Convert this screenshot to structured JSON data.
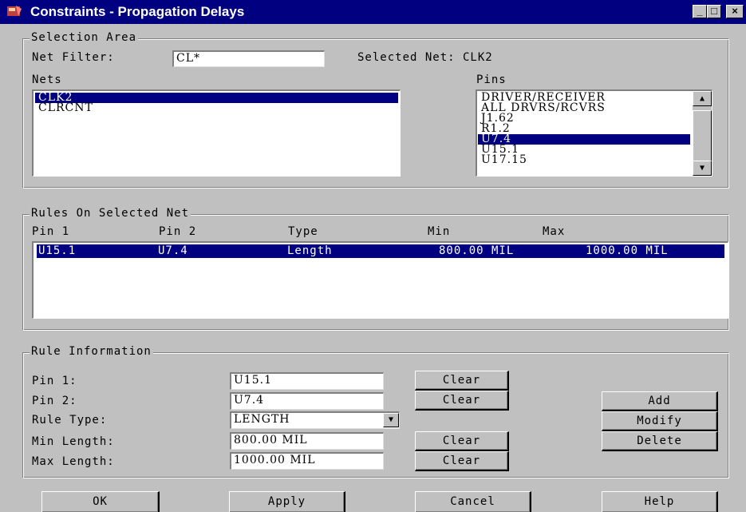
{
  "window": {
    "title": "Constraints - Propagation Delays",
    "controls": {
      "minimize": "_",
      "maximize": "□",
      "close": "×"
    }
  },
  "selection_area": {
    "legend": "Selection Area",
    "net_filter_label": "Net Filter:",
    "net_filter_value": "CL*",
    "selected_net_text": "Selected Net: CLK2",
    "nets_label": "Nets",
    "nets": [
      {
        "label": "CLK2",
        "selected": true
      },
      {
        "label": "CLRCNT",
        "selected": false
      }
    ],
    "pins_label": "Pins",
    "pins": [
      {
        "label": "DRIVER/RECEIVER",
        "selected": false
      },
      {
        "label": "ALL DRVRS/RCVRS",
        "selected": false
      },
      {
        "label": "J1.62",
        "selected": false
      },
      {
        "label": "R1.2",
        "selected": false
      },
      {
        "label": "U7.4",
        "selected": true
      },
      {
        "label": "U15.1",
        "selected": false
      },
      {
        "label": "U17.15",
        "selected": false
      }
    ]
  },
  "rules": {
    "legend": "Rules On Selected Net",
    "columns": [
      "Pin 1",
      "Pin 2",
      "Type",
      "Min",
      "Max"
    ],
    "rows": [
      {
        "pin1": "U15.1",
        "pin2": "U7.4",
        "type": "Length",
        "min": "800.00 MIL",
        "max": "1000.00 MIL",
        "selected": true
      }
    ]
  },
  "rule_info": {
    "legend": "Rule Information",
    "pin1_label": "Pin 1:",
    "pin1_value": "U15.1",
    "pin2_label": "Pin 2:",
    "pin2_value": "U7.4",
    "rule_type_label": "Rule Type:",
    "rule_type_value": "LENGTH",
    "min_length_label": "Min Length:",
    "min_length_value": "800.00 MIL",
    "max_length_label": "Max Length:",
    "max_length_value": "1000.00 MIL",
    "clear_label": "Clear",
    "add_label": "Add",
    "modify_label": "Modify",
    "delete_label": "Delete"
  },
  "footer": {
    "ok_label": "OK",
    "apply_label": "Apply",
    "cancel_label": "Cancel",
    "help_label": "Help"
  }
}
